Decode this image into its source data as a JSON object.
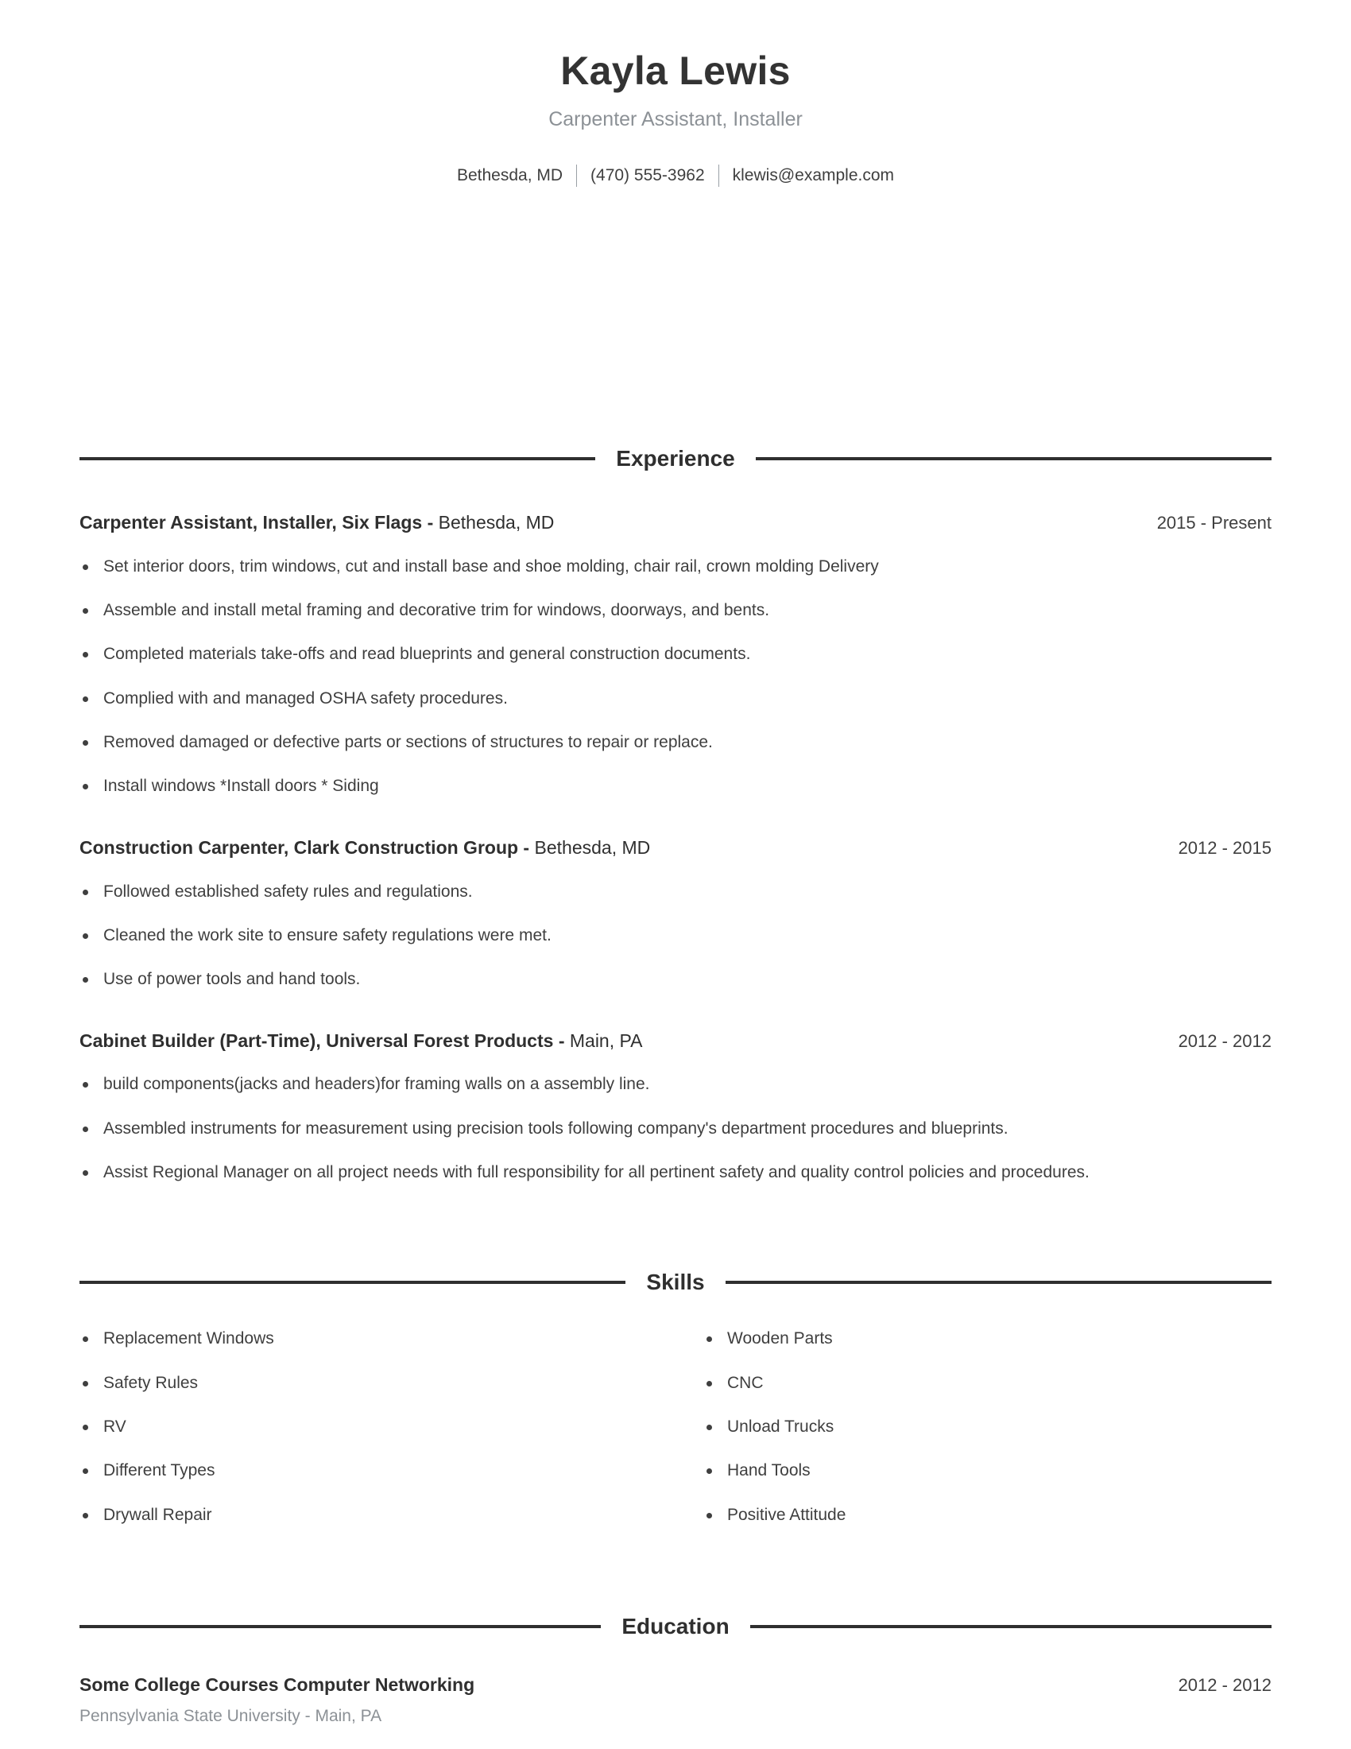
{
  "header": {
    "name": "Kayla Lewis",
    "job_title": "Carpenter Assistant, Installer",
    "contact": {
      "location": "Bethesda, MD",
      "phone": "(470) 555-3962",
      "email": "klewis@example.com"
    }
  },
  "sections": {
    "experience": {
      "title": "Experience",
      "entries": [
        {
          "role_company": "Carpenter Assistant, Installer, Six Flags -",
          "location": "Bethesda, MD",
          "dates": "2015 - Present",
          "bullets": [
            "Set interior doors, trim windows, cut and install base and shoe molding, chair rail, crown molding Delivery",
            "Assemble and install metal framing and decorative trim for windows, doorways, and bents.",
            "Completed materials take-offs and read blueprints and general construction documents.",
            "Complied with and managed OSHA safety procedures.",
            "Removed damaged or defective parts or sections of structures to repair or replace.",
            "Install windows *Install doors * Siding"
          ]
        },
        {
          "role_company": "Construction Carpenter, Clark Construction Group -",
          "location": "Bethesda, MD",
          "dates": "2012 - 2015",
          "bullets": [
            "Followed established safety rules and regulations.",
            "Cleaned the work site to ensure safety regulations were met.",
            "Use of power tools and hand tools."
          ]
        },
        {
          "role_company": "Cabinet Builder (Part-Time), Universal Forest Products -",
          "location": "Main, PA",
          "dates": "2012 - 2012",
          "bullets": [
            "build components(jacks and headers)for framing walls on a assembly line.",
            "Assembled instruments for measurement using precision tools following company's department procedures and blueprints.",
            "Assist Regional Manager on all project needs with full responsibility for all pertinent safety and quality control policies and procedures."
          ]
        }
      ]
    },
    "skills": {
      "title": "Skills",
      "column_left": [
        "Replacement Windows",
        "Safety Rules",
        "RV",
        "Different Types",
        "Drywall Repair"
      ],
      "column_right": [
        "Wooden Parts",
        "CNC",
        "Unload Trucks",
        "Hand Tools",
        "Positive Attitude"
      ]
    },
    "education": {
      "title": "Education",
      "entries": [
        {
          "degree": "Some College Courses Computer Networking",
          "school": "Pennsylvania State University - Main, PA",
          "dates": "2012 - 2012"
        }
      ]
    }
  },
  "colors": {
    "text_primary": "#3a3a3a",
    "text_heading": "#2f2f2f",
    "text_muted": "#8c9196",
    "rule": "#2f2f2f",
    "background": "#ffffff"
  }
}
